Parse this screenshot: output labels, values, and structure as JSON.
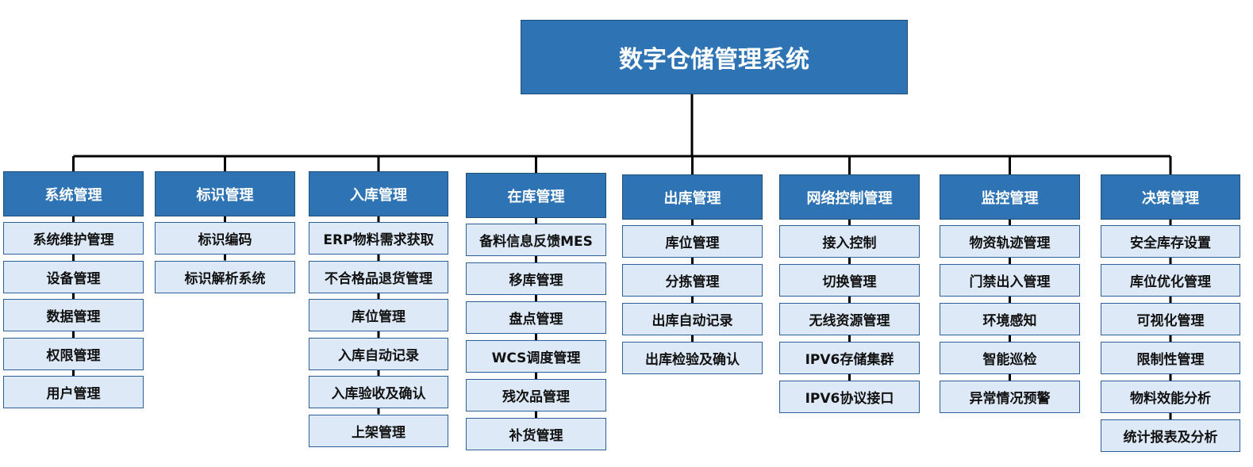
{
  "root": {
    "label": "数字仓储管理系统"
  },
  "colors": {
    "header": "#2e74b5",
    "item": "#dde9f6",
    "border": "#1f4e79",
    "line": "#000000"
  },
  "columns": [
    {
      "id": "system",
      "title": "系统管理",
      "items": [
        "系统维护管理",
        "设备管理",
        "数据管理",
        "权限管理",
        "用户管理"
      ]
    },
    {
      "id": "identity",
      "title": "标识管理",
      "items": [
        "标识编码",
        "标识解析系统"
      ]
    },
    {
      "id": "inbound",
      "title": "入库管理",
      "items": [
        "ERP物料需求获取",
        "不合格品退货管理",
        "库位管理",
        "入库自动记录",
        "入库验收及确认",
        "上架管理"
      ]
    },
    {
      "id": "inventory",
      "title": "在库管理",
      "items": [
        "备料信息反馈MES",
        "移库管理",
        "盘点管理",
        "WCS调度管理",
        "残次品管理",
        "补货管理"
      ]
    },
    {
      "id": "outbound",
      "title": "出库管理",
      "items": [
        "库位管理",
        "分拣管理",
        "出库自动记录",
        "出库检验及确认"
      ]
    },
    {
      "id": "network",
      "title": "网络控制管理",
      "items": [
        "接入控制",
        "切换管理",
        "无线资源管理",
        "IPV6存储集群",
        "IPV6协议接口"
      ]
    },
    {
      "id": "monitor",
      "title": "监控管理",
      "items": [
        "物资轨迹管理",
        "门禁出入管理",
        "环境感知",
        "智能巡检",
        "异常情况预警"
      ]
    },
    {
      "id": "decision",
      "title": "决策管理",
      "items": [
        "安全库存设置",
        "库位优化管理",
        "可视化管理",
        "限制性管理",
        "物料效能分析",
        "统计报表及分析"
      ]
    }
  ]
}
